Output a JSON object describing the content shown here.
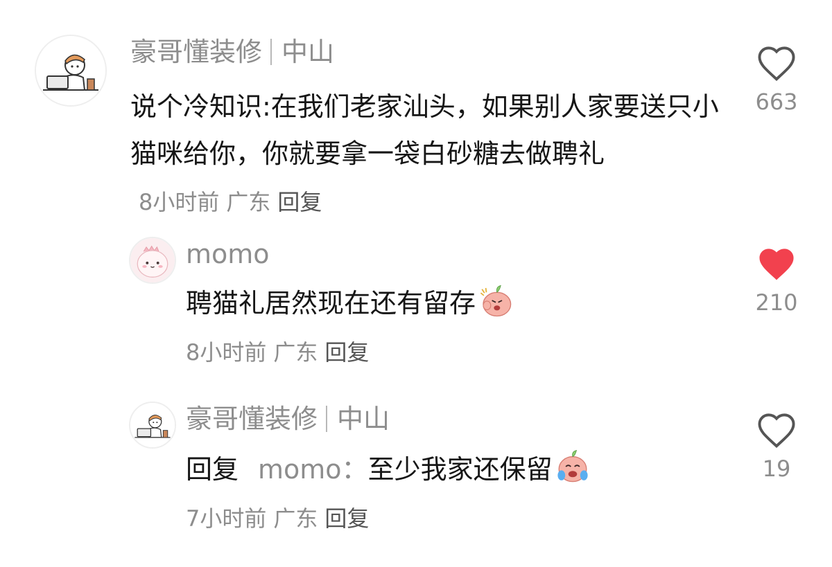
{
  "comments": [
    {
      "author": "豪哥懂装修",
      "location_tag": "中山",
      "text": "说个冷知识:在我们老家汕头，如果别人家要送只小猫咪给你，你就要拿一袋白砂糖去做聘礼",
      "time": "8小时前",
      "region": "广东",
      "reply_label": "回复",
      "likes": "663",
      "liked": false
    },
    {
      "author": "momo",
      "text": "聘猫礼居然现在还有留存",
      "emoji": "angry-peach-emoji",
      "time": "8小时前",
      "region": "广东",
      "reply_label": "回复",
      "likes": "210",
      "liked": true
    },
    {
      "author": "豪哥懂装修",
      "location_tag": "中山",
      "reply_prefix": "回复",
      "mention": "momo",
      "colon": "：",
      "text": "至少我家还保留",
      "emoji": "crying-peach-emoji",
      "time": "7小时前",
      "region": "广东",
      "reply_label": "回复",
      "likes": "19",
      "liked": false
    }
  ],
  "colors": {
    "like_active": "#f2414e",
    "meta_gray": "#8d8d8d",
    "text": "#161616"
  }
}
